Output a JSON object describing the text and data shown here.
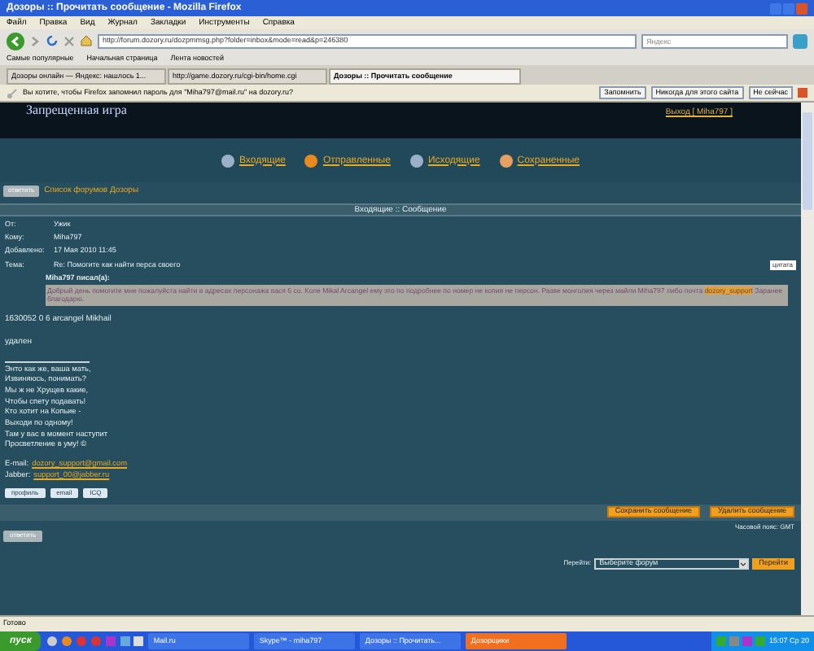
{
  "window": {
    "title": "Дозоры :: Прочитать сообщение - Mozilla Firefox"
  },
  "menu": [
    "Файл",
    "Правка",
    "Вид",
    "Журнал",
    "Закладки",
    "Инструменты",
    "Справка"
  ],
  "address": {
    "value": "http://forum.dozory.ru/dozpmmsg.php?folder=inbox&mode=read&p=246380"
  },
  "search": {
    "placeholder": "Яндекс"
  },
  "bookmarks": [
    "Самые популярные",
    "Начальная страница",
    "Лента новостей"
  ],
  "tabs": [
    {
      "label": "Дозоры онлайн — Яндекс: нашлось 1...",
      "selected": false
    },
    {
      "label": "http://game.dozory.ru/cgi-bin/home.cgi",
      "selected": false
    },
    {
      "label": "Дозоры :: Прочитать сообщение",
      "selected": true
    }
  ],
  "notification": {
    "text": "Вы хотите, чтобы Firefox запомнил пароль для \"Miha797@mail.ru\" на dozory.ru?",
    "buttons": [
      "Запомнить",
      "Никогда для этого сайта",
      "Не сейчас"
    ]
  },
  "banner": {
    "title": "Запрещенная игра",
    "logout": "Выход [ Miha797 ]"
  },
  "folders": [
    "Входящие",
    "Отправленные",
    "Исходящие",
    "Сохраненные"
  ],
  "breadcrumb": {
    "button": "ответить",
    "link": "Список форумов Дозоры"
  },
  "header": "Входящие :: Сообщение",
  "fields": [
    {
      "label": "От:",
      "value": "Ужик"
    },
    {
      "label": "Кому:",
      "value": "Miha797"
    },
    {
      "label": "Добавлено:",
      "value": "17 Мая 2010 11:45"
    },
    {
      "label": "Тема:",
      "value": "Re: Помогите как найти перса своего"
    }
  ],
  "quote_button": "цитата",
  "quote": {
    "author": "Miha797 писал(а):",
    "text": "Добрый день помогите мне пожалуйста найти в адресах персонажа вася 6 со. Коле Mikal Arcangel ему это по подробнее по номер не копия не персон. Разве монголия через майли Miha797 либо почта",
    "highlight": "dozory_support",
    "tail": "Заранее благодарю."
  },
  "body": [
    "1630052 0 6 arcangel Mikhail",
    "удален"
  ],
  "signature": [
    "Энто как же, ваша мать,",
    "Извиняюсь, понимать?",
    "Мы ж не Хрущев какие,",
    "Чтобы спету подавать!",
    "Кто хотит на Копьие -",
    "Выходи по одному!",
    "Там у вас в момент наступит",
    "Просветление в уму! ©"
  ],
  "contacts": [
    {
      "label": "E-mail:",
      "value": "dozory_support@gmail.com"
    },
    {
      "label": "Jabber:",
      "value": "support_00@jabber.ru"
    }
  ],
  "profile_buttons": [
    "профиль",
    "email",
    "ICQ"
  ],
  "actions": [
    "Сохранить сообщение",
    "Удалить сообщение"
  ],
  "timezone": "Часовой пояс: GMT",
  "reply_button": "ответить",
  "jump": {
    "label": "Перейти:",
    "value": "Выберите форум",
    "button": "Перейти"
  },
  "status_bar": "Готово",
  "taskbar": {
    "start": "пуск",
    "tasks": [
      {
        "label": "Mail.ru",
        "selected": false
      },
      {
        "label": "Skype™ - miha797",
        "selected": false
      },
      {
        "label": "Дозоры :: Прочитать...",
        "selected": false
      },
      {
        "label": "Дозорщики",
        "selected": true
      }
    ],
    "clock": "15:07 Ср 20"
  }
}
